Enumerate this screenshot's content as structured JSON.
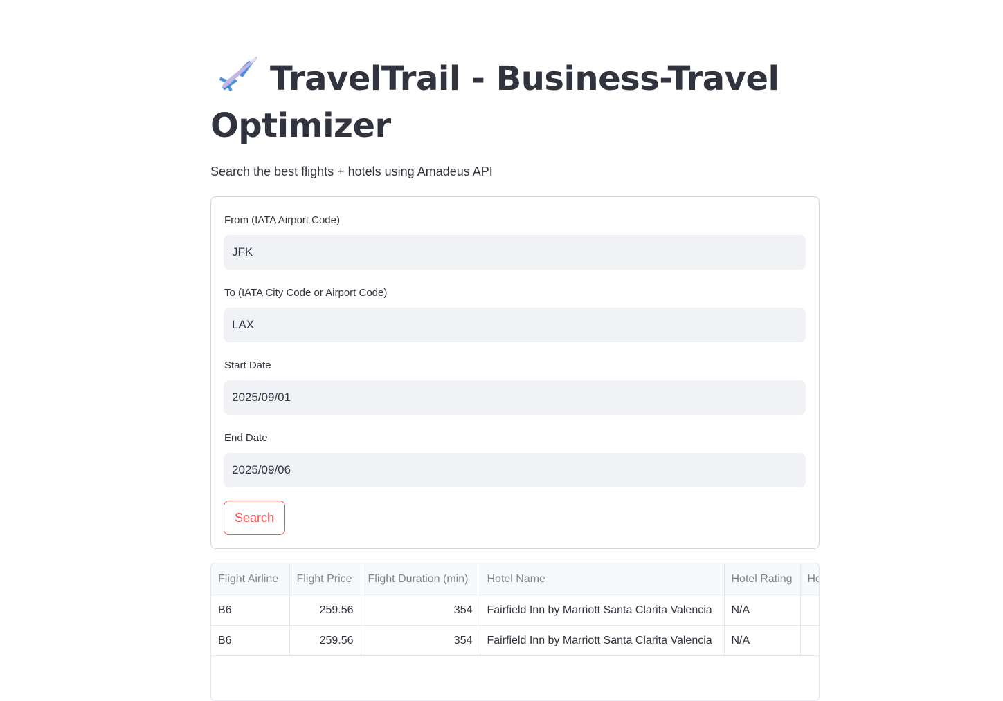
{
  "header": {
    "icon": "airplane-icon",
    "title": "TravelTrail - Business-Travel Optimizer",
    "subtitle": "Search the best flights + hotels using Amadeus API"
  },
  "form": {
    "from_label": "From (IATA Airport Code)",
    "from_value": "JFK",
    "to_label": "To (IATA City Code or Airport Code)",
    "to_value": "LAX",
    "start_label": "Start Date",
    "start_value": "2025/09/01",
    "end_label": "End Date",
    "end_value": "2025/09/06",
    "search_label": "Search"
  },
  "results": {
    "columns": [
      "Flight Airline",
      "Flight Price",
      "Flight Duration (min)",
      "Hotel Name",
      "Hotel Rating",
      "Ho"
    ],
    "rows": [
      [
        "B6",
        "259.56",
        "354",
        "Fairfield Inn by Marriott Santa Clarita Valencia",
        "N/A",
        ""
      ],
      [
        "B6",
        "259.56",
        "354",
        "Fairfield Inn by Marriott Santa Clarita Valencia",
        "N/A",
        ""
      ]
    ]
  },
  "colors": {
    "accent": "#ff4b4b",
    "input_bg": "#f0f2f6",
    "text": "#31333f"
  }
}
